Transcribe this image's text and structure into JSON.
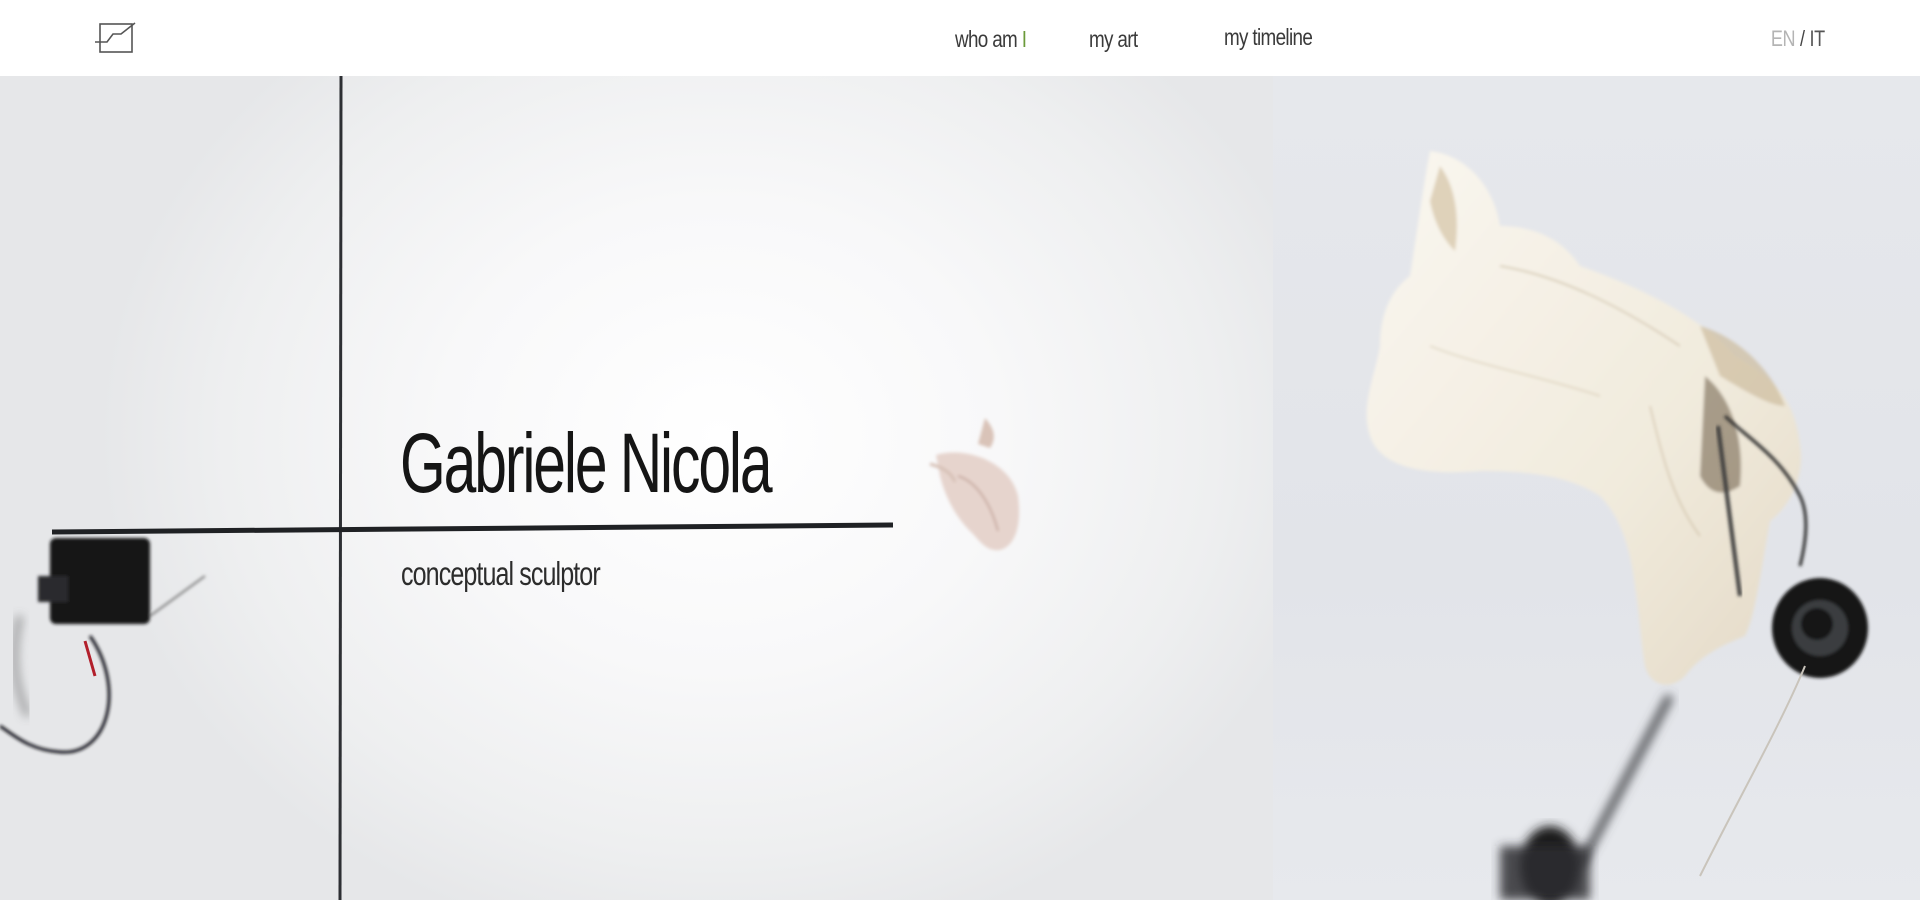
{
  "header": {
    "logo_icon": "framed-line-chart-icon",
    "nav": {
      "who_am": "who am ",
      "who_i": "I",
      "my_art": "my art",
      "my_timeline": "my timeline"
    },
    "lang": {
      "en": "EN",
      "separator": "/",
      "it": "IT",
      "active": "EN"
    }
  },
  "hero": {
    "title": "Gabriele Nicola",
    "subtitle": "conceptual sculptor",
    "images": [
      "kinetic-sculpture-photo",
      "animal-head-sculpture-photo"
    ]
  },
  "colors": {
    "accent": "#6b9a3a",
    "text": "#151515",
    "inactive_lang": "#b4b4b4"
  }
}
